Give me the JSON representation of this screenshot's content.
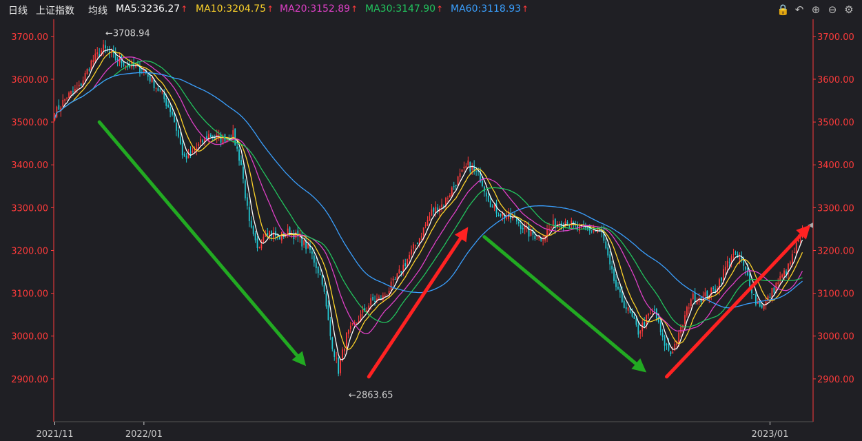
{
  "header": {
    "period": "日线",
    "index_name": "上证指数",
    "indicator": "均线",
    "ma": [
      {
        "key": "ma5",
        "label": "MA5:3236.27",
        "color": "#ffffff"
      },
      {
        "key": "ma10",
        "label": "MA10:3204.75",
        "color": "#ffd42a"
      },
      {
        "key": "ma20",
        "label": "MA20:3152.89",
        "color": "#e040c8"
      },
      {
        "key": "ma30",
        "label": "MA30:3147.90",
        "color": "#22c55e"
      },
      {
        "key": "ma60",
        "label": "MA60:3118.93",
        "color": "#3aa0ff"
      }
    ],
    "tools": [
      "lock-icon",
      "undo-icon",
      "zoom-in-icon",
      "zoom-out-icon",
      "settings-icon"
    ]
  },
  "chart_data": {
    "type": "candlestick",
    "ylim": [
      2800,
      3740
    ],
    "y_ticks": [
      "2900.00",
      "3000.00",
      "3100.00",
      "3200.00",
      "3300.00",
      "3400.00",
      "3500.00",
      "3600.00",
      "3700.00"
    ],
    "x_ticks": [
      {
        "label": "2021/11",
        "index": 0
      },
      {
        "label": "2022/01",
        "index": 44
      },
      {
        "label": "2023/01",
        "index": 353
      }
    ],
    "grid": false,
    "candle_count": 370,
    "anchors": [
      {
        "i": 0,
        "v": 3520
      },
      {
        "i": 6,
        "v": 3560
      },
      {
        "i": 12,
        "v": 3580
      },
      {
        "i": 18,
        "v": 3640
      },
      {
        "i": 24,
        "v": 3672
      },
      {
        "i": 30,
        "v": 3648
      },
      {
        "i": 38,
        "v": 3630
      },
      {
        "i": 44,
        "v": 3620
      },
      {
        "i": 52,
        "v": 3570
      },
      {
        "i": 58,
        "v": 3520
      },
      {
        "i": 64,
        "v": 3410
      },
      {
        "i": 70,
        "v": 3440
      },
      {
        "i": 76,
        "v": 3470
      },
      {
        "i": 82,
        "v": 3460
      },
      {
        "i": 88,
        "v": 3470
      },
      {
        "i": 92,
        "v": 3400
      },
      {
        "i": 96,
        "v": 3260
      },
      {
        "i": 100,
        "v": 3200
      },
      {
        "i": 104,
        "v": 3250
      },
      {
        "i": 110,
        "v": 3230
      },
      {
        "i": 116,
        "v": 3245
      },
      {
        "i": 120,
        "v": 3230
      },
      {
        "i": 126,
        "v": 3200
      },
      {
        "i": 132,
        "v": 3130
      },
      {
        "i": 136,
        "v": 3000
      },
      {
        "i": 140,
        "v": 2920
      },
      {
        "i": 144,
        "v": 3000
      },
      {
        "i": 150,
        "v": 3040
      },
      {
        "i": 156,
        "v": 3080
      },
      {
        "i": 162,
        "v": 3090
      },
      {
        "i": 168,
        "v": 3130
      },
      {
        "i": 174,
        "v": 3180
      },
      {
        "i": 180,
        "v": 3230
      },
      {
        "i": 186,
        "v": 3290
      },
      {
        "i": 192,
        "v": 3310
      },
      {
        "i": 198,
        "v": 3360
      },
      {
        "i": 204,
        "v": 3400
      },
      {
        "i": 210,
        "v": 3370
      },
      {
        "i": 216,
        "v": 3300
      },
      {
        "i": 222,
        "v": 3280
      },
      {
        "i": 228,
        "v": 3270
      },
      {
        "i": 234,
        "v": 3240
      },
      {
        "i": 240,
        "v": 3230
      },
      {
        "i": 246,
        "v": 3260
      },
      {
        "i": 252,
        "v": 3270
      },
      {
        "i": 258,
        "v": 3250
      },
      {
        "i": 264,
        "v": 3250
      },
      {
        "i": 270,
        "v": 3240
      },
      {
        "i": 274,
        "v": 3160
      },
      {
        "i": 278,
        "v": 3100
      },
      {
        "i": 284,
        "v": 3050
      },
      {
        "i": 288,
        "v": 3010
      },
      {
        "i": 292,
        "v": 3040
      },
      {
        "i": 296,
        "v": 3060
      },
      {
        "i": 300,
        "v": 2990
      },
      {
        "i": 304,
        "v": 2960
      },
      {
        "i": 308,
        "v": 3000
      },
      {
        "i": 314,
        "v": 3090
      },
      {
        "i": 320,
        "v": 3090
      },
      {
        "i": 326,
        "v": 3110
      },
      {
        "i": 330,
        "v": 3150
      },
      {
        "i": 334,
        "v": 3190
      },
      {
        "i": 338,
        "v": 3180
      },
      {
        "i": 342,
        "v": 3140
      },
      {
        "i": 346,
        "v": 3080
      },
      {
        "i": 350,
        "v": 3070
      },
      {
        "i": 356,
        "v": 3120
      },
      {
        "i": 362,
        "v": 3160
      },
      {
        "i": 366,
        "v": 3210
      },
      {
        "i": 369,
        "v": 3240
      }
    ],
    "annotations": [
      {
        "label": "←3708.94",
        "index": 25,
        "value": 3708.94
      },
      {
        "label": "←2863.65",
        "index": 145,
        "value": 2863.65
      }
    ],
    "trend_arrows": [
      {
        "color": "#22aa22",
        "from": {
          "i": 22,
          "v": 3500
        },
        "to": {
          "i": 124,
          "v": 2930
        }
      },
      {
        "color": "#ff2222",
        "from": {
          "i": 155,
          "v": 2905
        },
        "to": {
          "i": 204,
          "v": 3255
        }
      },
      {
        "color": "#22aa22",
        "from": {
          "i": 212,
          "v": 3232
        },
        "to": {
          "i": 292,
          "v": 2915
        }
      },
      {
        "color": "#ff2222",
        "from": {
          "i": 302,
          "v": 2905
        },
        "to": {
          "i": 373,
          "v": 3260
        }
      }
    ],
    "colors": {
      "up": "#ff3b3b",
      "down": "#22cbd6",
      "axis": "#ff3b3b",
      "background": "#1f1f24"
    }
  }
}
